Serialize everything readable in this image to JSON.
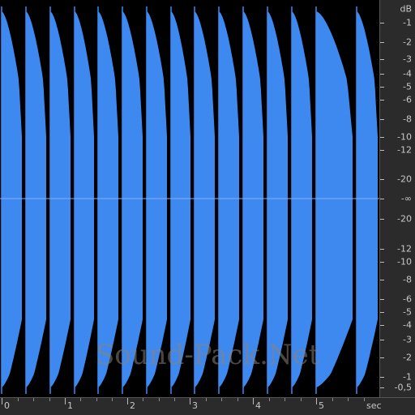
{
  "colors": {
    "waveform": "#3e89f0",
    "waveform_dark": "#2f6fd0",
    "background": "#000000",
    "ruler_bg": "#2b2b2b",
    "ruler_text": "#c8c8c8"
  },
  "db_ruler": {
    "unit": "dB",
    "labels": [
      "-1",
      "-2",
      "-3",
      "-4",
      "-5",
      "-6",
      "-8",
      "-10",
      "-12",
      "-20",
      "-∞",
      "-20",
      "-12",
      "-10",
      "-8",
      "-6",
      "-5",
      "-4",
      "-3",
      "-2",
      "-1",
      "-0,5"
    ]
  },
  "time_ruler": {
    "unit": "sec",
    "labels": [
      "0",
      "1",
      "2",
      "3",
      "4",
      "5"
    ]
  },
  "watermark": "Sound-Pack.Net",
  "waveform": {
    "hit_count": 15
  }
}
